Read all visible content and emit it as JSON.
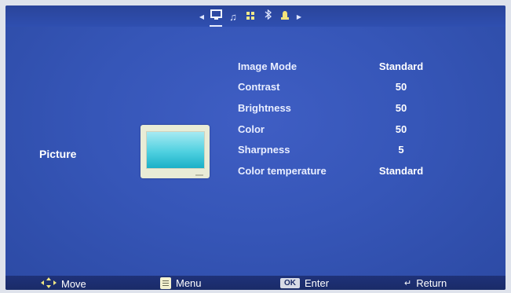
{
  "tabs": [
    {
      "icon": "monitor-icon",
      "active": true
    },
    {
      "icon": "music-note-icon",
      "active": false
    },
    {
      "icon": "grid-icon",
      "active": false
    },
    {
      "icon": "bluetooth-icon",
      "active": false
    },
    {
      "icon": "lock-icon",
      "active": false
    }
  ],
  "section": {
    "title": "Picture"
  },
  "settings": [
    {
      "label": "Image Mode",
      "value": "Standard"
    },
    {
      "label": "Contrast",
      "value": "50"
    },
    {
      "label": "Brightness",
      "value": "50"
    },
    {
      "label": "Color",
      "value": "50"
    },
    {
      "label": "Sharpness",
      "value": "5"
    },
    {
      "label": "Color temperature",
      "value": "Standard"
    }
  ],
  "hints": {
    "move": "Move",
    "menu": "Menu",
    "ok_key": "OK",
    "enter": "Enter",
    "return": "Return"
  },
  "colors": {
    "background": "#3656b8",
    "topbar": "#2a449a",
    "bottombar": "#1f3279",
    "text": "#ffffff"
  }
}
